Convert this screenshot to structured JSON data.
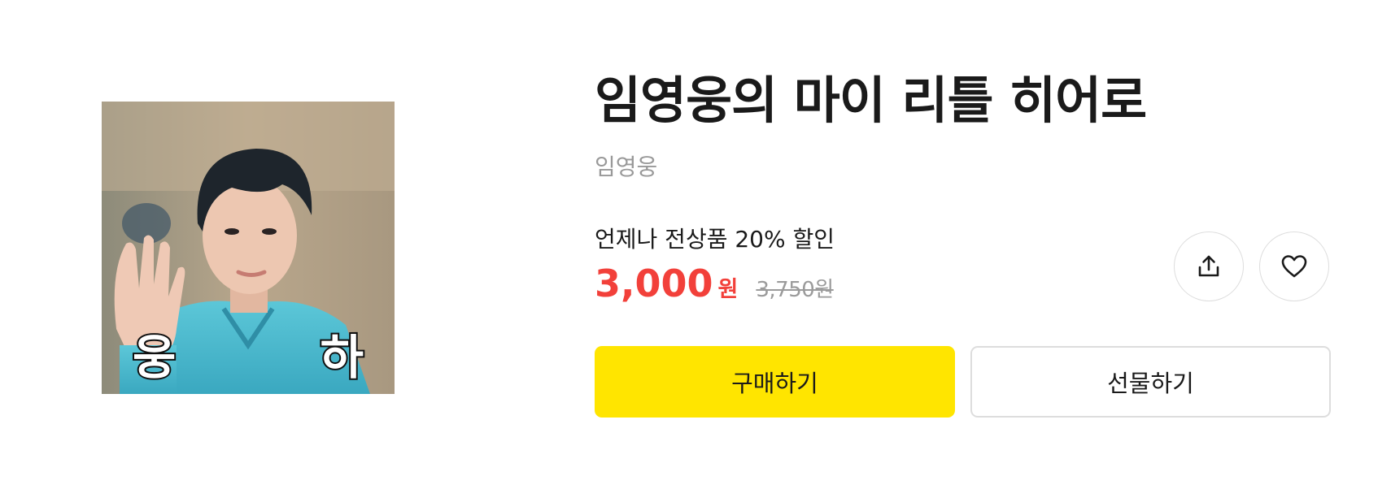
{
  "product": {
    "title": "임영웅의 마이 리틀 히어로",
    "author": "임영웅",
    "thumbnail": {
      "caption_left": "웅",
      "caption_right": "하"
    }
  },
  "pricing": {
    "promo_text": "언제나 전상품 20% 할인",
    "price": "3,000",
    "price_unit": "원",
    "original_price": "3,750원",
    "price_color": "#f2403a"
  },
  "actions": {
    "buy_label": "구매하기",
    "gift_label": "선물하기",
    "share_icon": "share-icon",
    "like_icon": "heart-icon",
    "buy_color": "#ffe500"
  }
}
